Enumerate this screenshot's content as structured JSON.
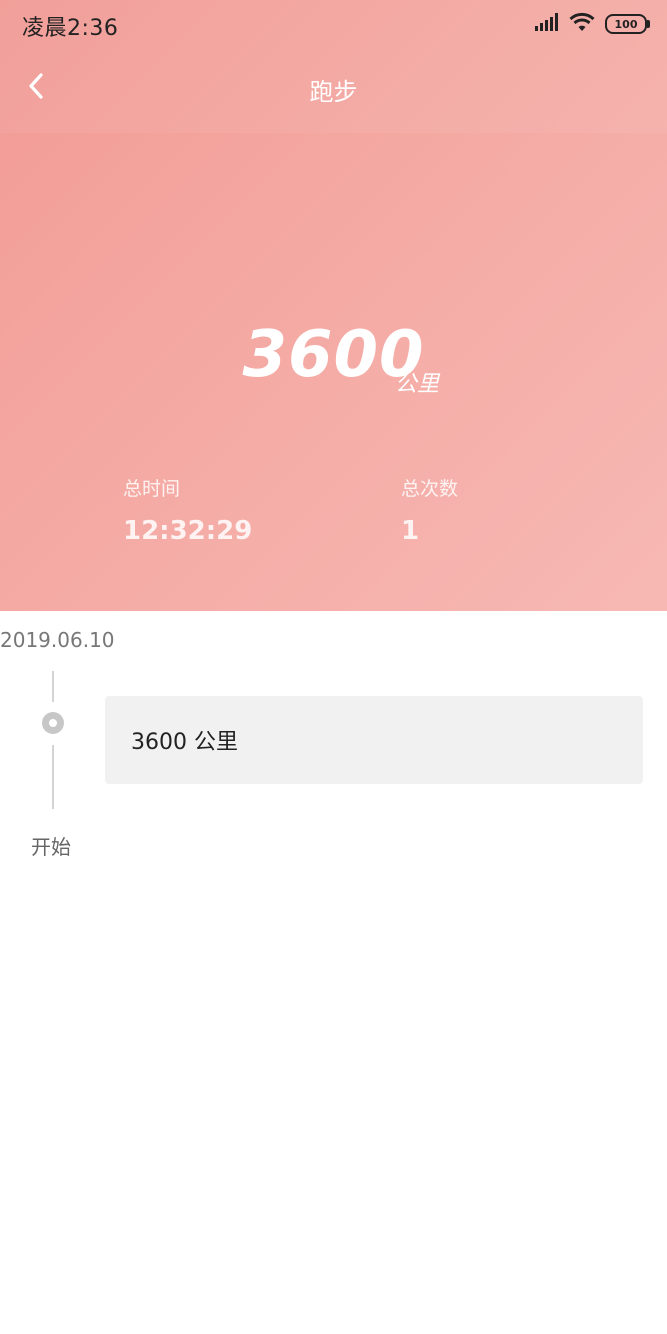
{
  "status_bar": {
    "time": "凌晨2:36",
    "battery": "100",
    "icons": [
      "signal-icon",
      "wifi-icon",
      "battery-icon"
    ]
  },
  "nav": {
    "back_icon": "chevron-left-icon",
    "title": "跑步"
  },
  "summary": {
    "distance_value": "3600",
    "distance_unit": "公里",
    "total_time_label": "总时间",
    "total_time_value": "12:32:29",
    "total_count_label": "总次数",
    "total_count_value": "1"
  },
  "timeline": {
    "date": "2019.06.10",
    "records": [
      {
        "text": "3600 公里"
      }
    ],
    "start_label": "开始"
  },
  "colors": {
    "hero_start": "#f29a94",
    "hero_end": "#f7b8b4",
    "card_bg": "#f1f1f1",
    "timeline": "#c7c7c7"
  }
}
